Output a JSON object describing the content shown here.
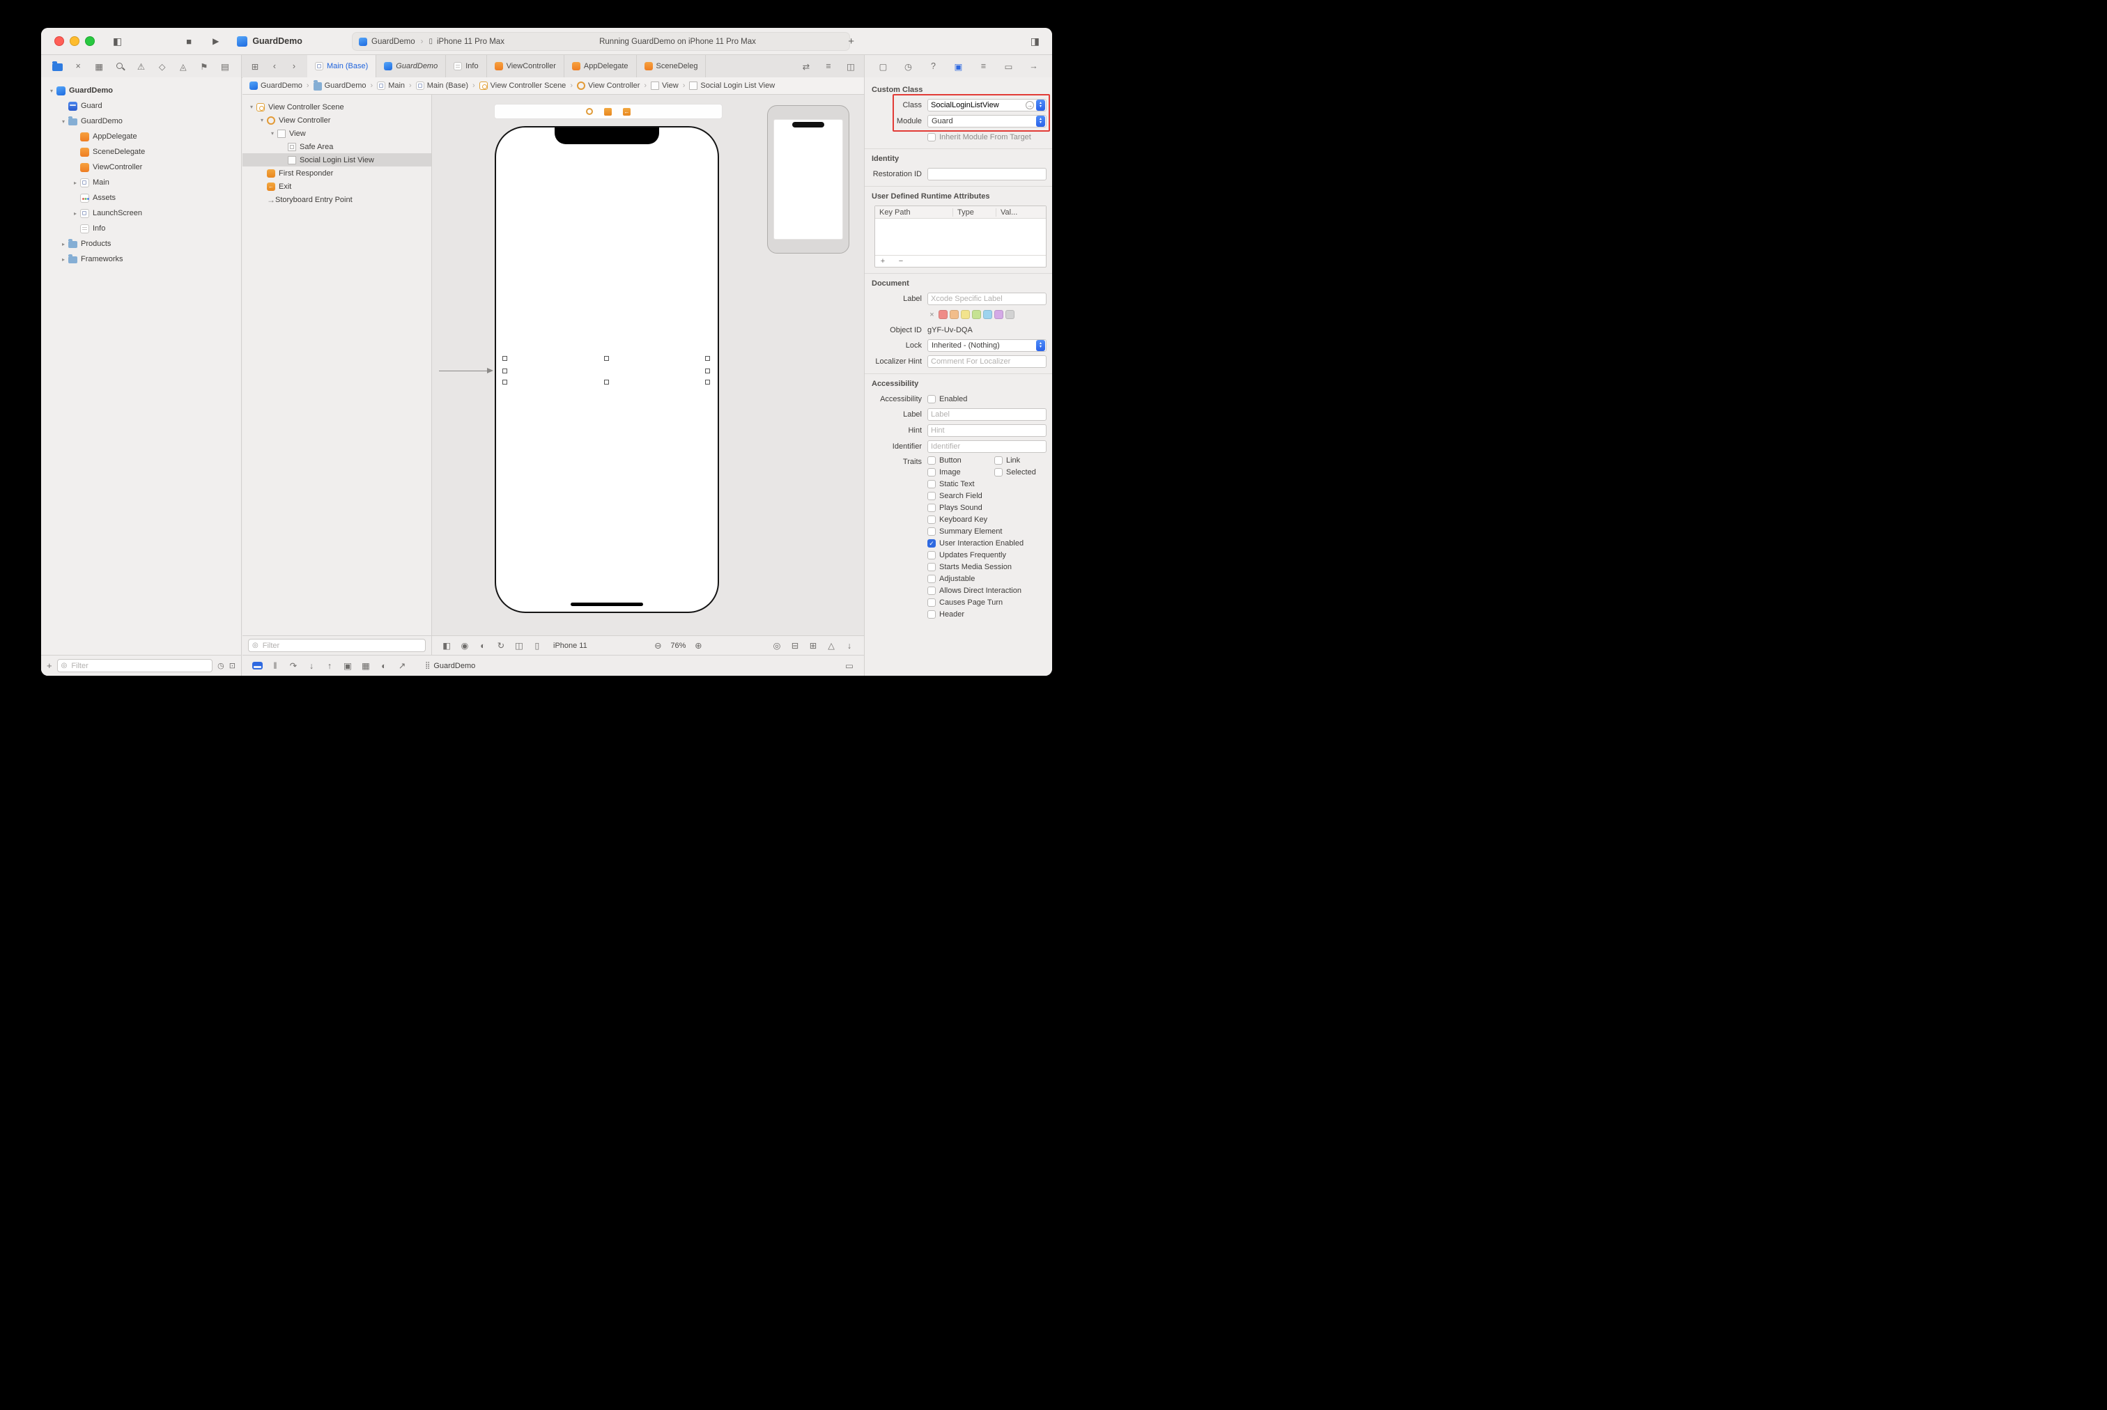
{
  "titlebar": {
    "app_title": "GuardDemo",
    "scheme_name": "GuardDemo",
    "scheme_device": "iPhone 11 Pro Max",
    "status": "Running GuardDemo on iPhone 11 Pro Max",
    "new_tab_glyph": "+",
    "stop_glyph": "■",
    "run_glyph": "▶",
    "left_sidebar_glyph": "◧",
    "right_sidebar_glyph": "◨",
    "crumb_sep_glyph": "›",
    "phone_glyph": "▯"
  },
  "chrome": {
    "nav_toolbar": [
      {
        "name": "project-navigator-button",
        "cls": "ic-folderblue",
        "active": true
      },
      {
        "name": "source-control-navigator-button",
        "glyph": "×"
      },
      {
        "name": "symbol-navigator-button",
        "glyph": "▦"
      },
      {
        "name": "find-navigator-button",
        "cls": "ic-mag"
      },
      {
        "name": "issue-navigator-button",
        "glyph": "⚠"
      },
      {
        "name": "test-navigator-button",
        "glyph": "◇"
      },
      {
        "name": "debug-navigator-button",
        "glyph": "◬"
      },
      {
        "name": "breakpoint-navigator-button",
        "glyph": "⚑"
      },
      {
        "name": "report-navigator-button",
        "glyph": "▤"
      }
    ],
    "tab_strip_left": [
      {
        "name": "editor-grid-button",
        "glyph": "⊞"
      },
      {
        "name": "back-button",
        "glyph": "‹"
      },
      {
        "name": "forward-button",
        "glyph": "›"
      }
    ],
    "tab_strip_right": [
      {
        "name": "editor-swap-button",
        "glyph": "⇄"
      },
      {
        "name": "editor-options-button",
        "glyph": "≡"
      },
      {
        "name": "add-editor-button",
        "glyph": "◫"
      }
    ],
    "inspector_toolbar": [
      {
        "name": "file-inspector-button",
        "glyph": "▢"
      },
      {
        "name": "history-inspector-button",
        "glyph": "◷"
      },
      {
        "name": "quick-help-inspector-button",
        "glyph": "?"
      },
      {
        "name": "identity-inspector-button",
        "glyph": "▣",
        "active": true
      },
      {
        "name": "attributes-inspector-button",
        "glyph": "≡"
      },
      {
        "name": "size-inspector-button",
        "glyph": "▭"
      },
      {
        "name": "connections-inspector-button",
        "glyph": "→"
      }
    ],
    "canvas_bar_left": [
      {
        "name": "canvas-outline-toggle-button",
        "glyph": "◧"
      },
      {
        "name": "accessibility-preview-button",
        "glyph": "◉"
      },
      {
        "name": "appearance-toggle-button",
        "glyph": "◐"
      },
      {
        "name": "orientation-button",
        "glyph": "↻"
      },
      {
        "name": "split-preview-button",
        "glyph": "◫"
      },
      {
        "name": "device-select-button",
        "glyph": "▯"
      }
    ],
    "canvas_bar_right": [
      {
        "name": "update-frames-button",
        "glyph": "◎"
      },
      {
        "name": "embed-button",
        "glyph": "⊟"
      },
      {
        "name": "align-button",
        "glyph": "⊞"
      },
      {
        "name": "add-constraints-button",
        "glyph": "△"
      },
      {
        "name": "resolve-layout-button",
        "glyph": "↓"
      }
    ],
    "debug_bar_left": [
      {
        "name": "debug-area-toggle-button",
        "cls": "ic-bluerect",
        "active": true
      },
      {
        "name": "pause-button",
        "glyph": "‖"
      },
      {
        "name": "step-over-button",
        "glyph": "↷"
      },
      {
        "name": "step-into-button",
        "glyph": "↓"
      },
      {
        "name": "step-out-button",
        "glyph": "↑"
      },
      {
        "name": "view-hierarchy-button",
        "glyph": "▣"
      },
      {
        "name": "memory-graph-button",
        "glyph": "▦"
      },
      {
        "name": "environment-overrides-button",
        "glyph": "◐"
      },
      {
        "name": "simulate-location-button",
        "glyph": "↗"
      }
    ],
    "debug_bar_right": [
      {
        "name": "show-debug-area-button",
        "glyph": "▭"
      }
    ],
    "nav_bottom": {
      "add_glyph": "+",
      "filter_glyph": "◎",
      "recent_glyph": "◷",
      "scm_glyph": "⊡"
    },
    "app_grid_glyph": "⣿"
  },
  "tabs": {
    "items": [
      {
        "label": "Main (Base)",
        "icon": "storyboard",
        "active": true
      },
      {
        "label": "GuardDemo",
        "icon": "app",
        "preview": true
      },
      {
        "label": "Info",
        "icon": "plist"
      },
      {
        "label": "ViewController",
        "icon": "swift"
      },
      {
        "label": "AppDelegate",
        "icon": "swift"
      },
      {
        "label": "SceneDeleg",
        "icon": "swift"
      }
    ]
  },
  "breadcrumb": {
    "items": [
      {
        "label": "GuardDemo",
        "icon": "app"
      },
      {
        "label": "GuardDemo",
        "icon": "folder"
      },
      {
        "label": "Main",
        "icon": "storyboard"
      },
      {
        "label": "Main (Base)",
        "icon": "storyboard"
      },
      {
        "label": "View Controller Scene",
        "icon": "scene"
      },
      {
        "label": "View Controller",
        "icon": "vc"
      },
      {
        "label": "View",
        "icon": "view"
      },
      {
        "label": "Social Login List View",
        "icon": "view"
      }
    ]
  },
  "navigator": {
    "filter_placeholder": "Filter",
    "items": [
      {
        "label": "GuardDemo",
        "icon": "app",
        "level": 0,
        "disclosure": "down",
        "bold": true
      },
      {
        "label": "Guard",
        "icon": "case",
        "level": 1,
        "disclosure": null
      },
      {
        "label": "GuardDemo",
        "icon": "folder",
        "level": 1,
        "disclosure": "down"
      },
      {
        "label": "AppDelegate",
        "icon": "swift",
        "level": 2,
        "disclosure": null
      },
      {
        "label": "SceneDelegate",
        "icon": "swift",
        "level": 2,
        "disclosure": null
      },
      {
        "label": "ViewController",
        "icon": "swift",
        "level": 2,
        "disclosure": null
      },
      {
        "label": "Main",
        "icon": "storyboard",
        "level": 2,
        "disclosure": "right"
      },
      {
        "label": "Assets",
        "icon": "assets",
        "level": 2,
        "disclosure": null
      },
      {
        "label": "LaunchScreen",
        "icon": "storyboard",
        "level": 2,
        "disclosure": "right"
      },
      {
        "label": "Info",
        "icon": "plist",
        "level": 2,
        "disclosure": null
      },
      {
        "label": "Products",
        "icon": "folder",
        "level": 1,
        "disclosure": "right"
      },
      {
        "label": "Frameworks",
        "icon": "folder",
        "level": 1,
        "disclosure": "right"
      }
    ]
  },
  "outline": {
    "filter_placeholder": "Filter",
    "items": [
      {
        "label": "View Controller Scene",
        "icon": "scene",
        "level": 0,
        "disclosure": "down"
      },
      {
        "label": "View Controller",
        "icon": "vc",
        "level": 1,
        "disclosure": "down"
      },
      {
        "label": "View",
        "icon": "view",
        "level": 2,
        "disclosure": "down"
      },
      {
        "label": "Safe Area",
        "icon": "safearea",
        "level": 3,
        "disclosure": null
      },
      {
        "label": "Social Login List View",
        "icon": "view",
        "level": 3,
        "disclosure": null,
        "selected": true
      },
      {
        "label": "First Responder",
        "icon": "responder",
        "level": 1,
        "disclosure": null
      },
      {
        "label": "Exit",
        "icon": "exit",
        "level": 1,
        "disclosure": null
      },
      {
        "label": "Storyboard Entry Point",
        "icon": "entry",
        "level": 1,
        "disclosure": null
      }
    ]
  },
  "canvas": {
    "zoom": "76%",
    "device": "iPhone 11",
    "zoom_out_glyph": "⊖",
    "zoom_in_glyph": "⊕"
  },
  "debug": {
    "project": "GuardDemo"
  },
  "inspector": {
    "custom_class": {
      "title": "Custom Class",
      "class_label": "Class",
      "class_value": "SocialLoginListView",
      "module_label": "Module",
      "module_value": "Guard",
      "inherit_label": "Inherit Module From Target"
    },
    "identity": {
      "title": "Identity",
      "restoration_label": "Restoration ID"
    },
    "runtime_attributes": {
      "title": "User Defined Runtime Attributes",
      "columns": [
        "Key Path",
        "Type",
        "Val..."
      ],
      "add_label": "+",
      "remove_label": "−"
    },
    "document": {
      "title": "Document",
      "label_label": "Label",
      "label_placeholder": "Xcode Specific Label",
      "none_swatch_glyph": "×",
      "swatch_colors": [
        "#ef8b87",
        "#f2bd8a",
        "#f2e38c",
        "#c5e292",
        "#9dd3ee",
        "#d4aae6",
        "#d2d2d2"
      ],
      "object_id_label": "Object ID",
      "object_id_value": "gYF-Uv-DQA",
      "lock_label": "Lock",
      "lock_value": "Inherited - (Nothing)",
      "localizer_label": "Localizer Hint",
      "localizer_placeholder": "Comment For Localizer"
    },
    "accessibility": {
      "title": "Accessibility",
      "enabled_row_label": "Accessibility",
      "enabled_label": "Enabled",
      "label_label": "Label",
      "label_placeholder": "Label",
      "hint_label": "Hint",
      "hint_placeholder": "Hint",
      "identifier_label": "Identifier",
      "identifier_placeholder": "Identifier"
    },
    "traits": {
      "label": "Traits",
      "rows": [
        [
          {
            "label": "Button",
            "checked": false
          },
          {
            "label": "Link",
            "checked": false
          }
        ],
        [
          {
            "label": "Image",
            "checked": false
          },
          {
            "label": "Selected",
            "checked": false
          }
        ],
        [
          {
            "label": "Static Text",
            "checked": false
          }
        ],
        [
          {
            "label": "Search Field",
            "checked": false
          }
        ],
        [
          {
            "label": "Plays Sound",
            "checked": false
          }
        ],
        [
          {
            "label": "Keyboard Key",
            "checked": false
          }
        ],
        [
          {
            "label": "Summary Element",
            "checked": false
          }
        ],
        [
          {
            "label": "User Interaction Enabled",
            "checked": true
          }
        ],
        [
          {
            "label": "Updates Frequently",
            "checked": false
          }
        ],
        [
          {
            "label": "Starts Media Session",
            "checked": false
          }
        ],
        [
          {
            "label": "Adjustable",
            "checked": false
          }
        ],
        [
          {
            "label": "Allows Direct Interaction",
            "checked": false
          }
        ],
        [
          {
            "label": "Causes Page Turn",
            "checked": false
          }
        ],
        [
          {
            "label": "Header",
            "checked": false
          }
        ]
      ]
    }
  }
}
